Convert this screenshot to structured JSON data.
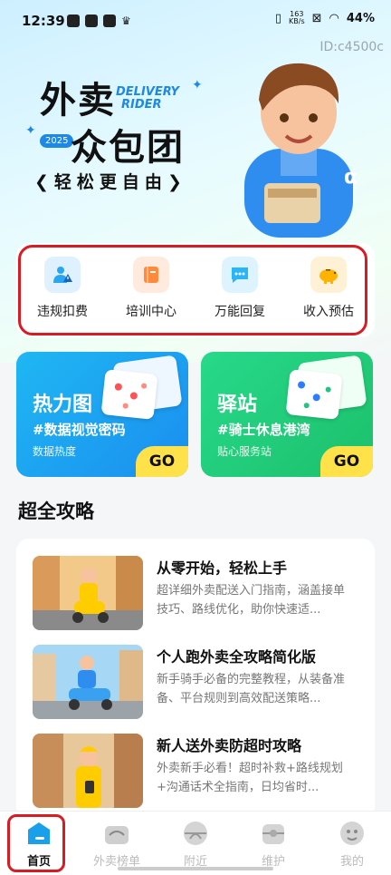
{
  "status_bar": {
    "time": "12:39",
    "net_speed_value": "163",
    "net_speed_unit": "KB/s",
    "battery": "44%"
  },
  "id_tag": "ID:c4500c",
  "hero": {
    "title_line1": "外卖",
    "title_line2": "众包团",
    "tagline_en_1": "DELIVERY",
    "tagline_en_2": "RIDER",
    "year": "2025",
    "slogan": "轻松更自由"
  },
  "quick_menu": [
    {
      "label": "违规扣费",
      "icon": "warning-person-icon",
      "color": "#2aa6f0",
      "bg": "#dff1ff"
    },
    {
      "label": "培训中心",
      "icon": "book-icon",
      "color": "#ff8a3c",
      "bg": "#ffeadd"
    },
    {
      "label": "万能回复",
      "icon": "chat-bubble-icon",
      "color": "#29b6f6",
      "bg": "#ddf4ff"
    },
    {
      "label": "收入预估",
      "icon": "piggy-bank-icon",
      "color": "#ffb300",
      "bg": "#fff1d6"
    }
  ],
  "feature_cards": [
    {
      "title": "热力图",
      "subtitle": "#数据视觉密码",
      "desc": "数据热度",
      "cta": "GO"
    },
    {
      "title": "驿站",
      "subtitle": "#骑士休息港湾",
      "desc": "贴心服务站",
      "cta": "GO"
    }
  ],
  "guides_section": {
    "title": "超全攻略",
    "items": [
      {
        "title": "从零开始，轻松上手",
        "desc": "超详细外卖配送入门指南，涵盖接单技巧、路线优化，助你快速适..."
      },
      {
        "title": "个人跑外卖全攻略简化版",
        "desc": "新手骑手必备的完整教程，从装备准备、平台规则到高效配送策略..."
      },
      {
        "title": "新人送外卖防超时攻略",
        "desc": "外卖新手必看！超时补救+路线规划+沟通话术全指南，日均省时..."
      }
    ]
  },
  "bottom_nav": [
    {
      "label": "首页",
      "active": true
    },
    {
      "label": "外卖榜单",
      "active": false
    },
    {
      "label": "附近",
      "active": false
    },
    {
      "label": "维护",
      "active": false
    },
    {
      "label": "我的",
      "active": false
    }
  ],
  "colors": {
    "accent_blue": "#1e88e5",
    "heat_card": "#1fb7f2",
    "station_card": "#23d17a",
    "go_button": "#ffe14a",
    "highlight_outline": "#d81c24"
  }
}
